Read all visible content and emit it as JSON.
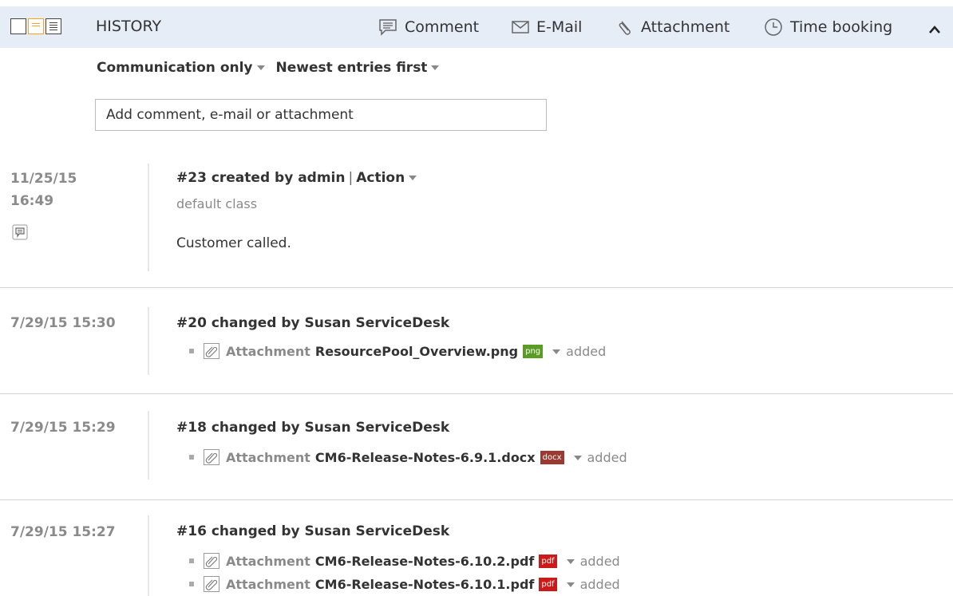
{
  "header": {
    "title": "HISTORY",
    "actions": {
      "comment": "Comment",
      "email": "E-Mail",
      "attachment": "Attachment",
      "time_booking": "Time booking"
    },
    "icons": [
      "single-column-view-icon",
      "two-column-view-icon",
      "list-view-icon"
    ],
    "active_view_color": "#f5a21e",
    "background": "#e6edf7"
  },
  "filters": {
    "scope": "Communication only",
    "order": "Newest entries first"
  },
  "add_box": {
    "placeholder": "Add comment, e-mail or attachment"
  },
  "entries": [
    {
      "date": "11/25/15",
      "time": "16:49",
      "title": "#23 created by admin",
      "action": "Action",
      "class": "default class",
      "text": "Customer called."
    },
    {
      "timestamp": "7/29/15 15:30",
      "title": "#20 changed by Susan ServiceDesk",
      "attachments": [
        {
          "label": "Attachment",
          "file": "ResourcePool_Overview.png",
          "type": "png",
          "color": "#5a9c24",
          "status": "added"
        }
      ]
    },
    {
      "timestamp": "7/29/15 15:29",
      "title": "#18 changed by Susan ServiceDesk",
      "attachments": [
        {
          "label": "Attachment",
          "file": "CM6-Release-Notes-6.9.1.docx",
          "type": "docx",
          "color": "#9a3a32",
          "status": "added"
        }
      ]
    },
    {
      "timestamp": "7/29/15 15:27",
      "title": "#16 changed by Susan ServiceDesk",
      "attachments": [
        {
          "label": "Attachment",
          "file": "CM6-Release-Notes-6.10.2.pdf",
          "type": "pdf",
          "color": "#cc1a1a",
          "status": "added"
        },
        {
          "label": "Attachment",
          "file": "CM6-Release-Notes-6.10.1.pdf",
          "type": "pdf",
          "color": "#cc1a1a",
          "status": "added"
        }
      ]
    }
  ]
}
